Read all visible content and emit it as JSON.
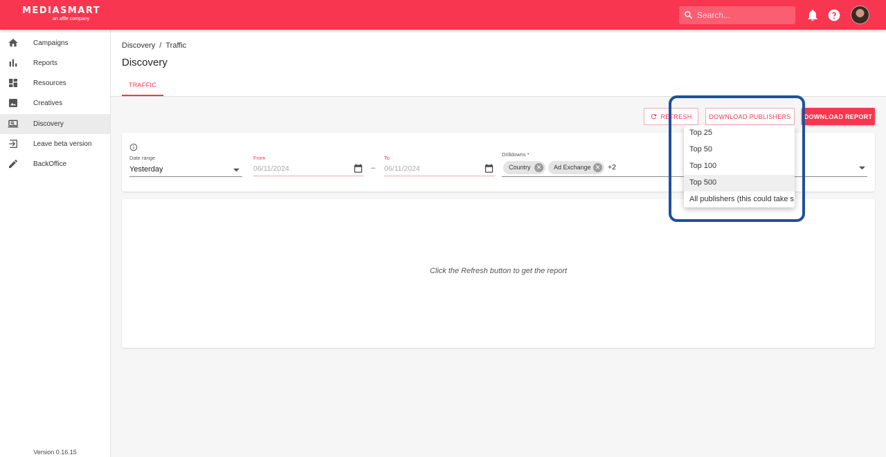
{
  "app": {
    "brand": "MEDIASMART",
    "brand_sub": "an affle company",
    "search_placeholder": "Search..."
  },
  "sidebar": {
    "items": [
      {
        "label": "Campaigns",
        "icon": "home-icon"
      },
      {
        "label": "Reports",
        "icon": "bar-chart-icon"
      },
      {
        "label": "Resources",
        "icon": "dashboard-icon"
      },
      {
        "label": "Creatives",
        "icon": "image-icon"
      },
      {
        "label": "Discovery",
        "icon": "laptop-search-icon"
      },
      {
        "label": "Leave beta version",
        "icon": "exit-icon"
      },
      {
        "label": "BackOffice",
        "icon": "pencil-icon"
      }
    ],
    "active": "Discovery",
    "version": "Version 0.16.15"
  },
  "header": {
    "breadcrumb": [
      "Discovery",
      "Traffic"
    ],
    "breadcrumb_sep": "/",
    "title": "Discovery",
    "tabs": [
      {
        "label": "TRAFFIC",
        "active": true
      }
    ]
  },
  "toolbar": {
    "refresh_label": "REFRESH",
    "download_publishers_label": "DOWNLOAD PUBLISHERS",
    "download_report_label": "DOWNLOAD REPORT"
  },
  "filters": {
    "date_range": {
      "label": "Date range",
      "value": "Yesterday"
    },
    "from": {
      "label": "From",
      "placeholder": "06/11/2024"
    },
    "range_sep": "–",
    "to": {
      "label": "To",
      "placeholder": "06/11/2024"
    },
    "drilldowns": {
      "label": "Drilldowns *",
      "chips": [
        "Country",
        "Ad Exchange"
      ],
      "more": "+2"
    }
  },
  "result": {
    "message": "Click the Refresh button to get the report"
  },
  "publishers_menu": {
    "items": [
      "Top 25",
      "Top 50",
      "Top 100",
      "Top 500",
      "All publishers (this could take s"
    ],
    "hovered": "Top 500"
  },
  "colors": {
    "brand": "#f93650",
    "highlight": "#1f4f9f"
  }
}
